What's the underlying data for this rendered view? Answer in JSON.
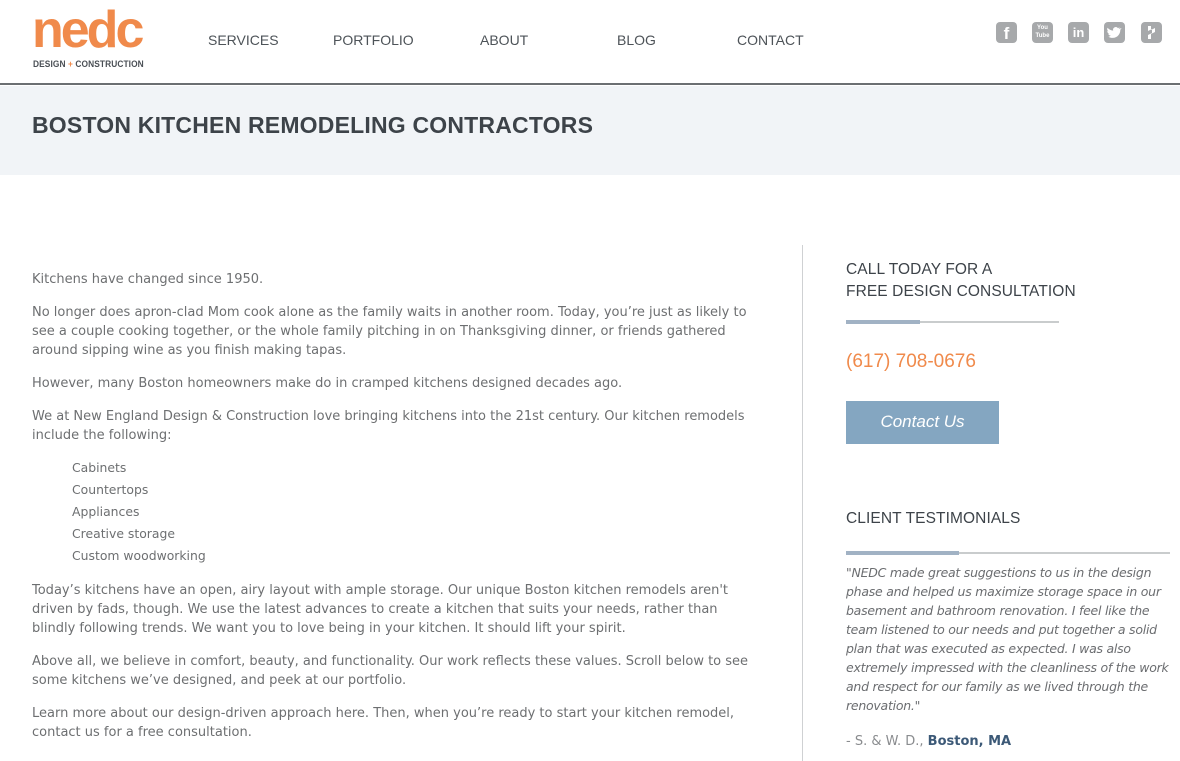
{
  "header": {
    "logo": {
      "word": "nedc",
      "sub_left": "DESIGN",
      "sub_plus": "+",
      "sub_right": "CONSTRUCTION"
    },
    "nav": [
      {
        "label": "SERVICES"
      },
      {
        "label": "PORTFOLIO"
      },
      {
        "label": "ABOUT"
      },
      {
        "label": "BLOG"
      },
      {
        "label": "CONTACT"
      }
    ],
    "social": [
      {
        "name": "facebook-icon",
        "glyph": "f"
      },
      {
        "name": "youtube-icon",
        "glyph": "You Tube"
      },
      {
        "name": "linkedin-icon",
        "glyph": "in"
      },
      {
        "name": "twitter-icon",
        "glyph": "t"
      },
      {
        "name": "houzz-icon",
        "glyph": "h"
      }
    ]
  },
  "banner": {
    "title": "BOSTON KITCHEN REMODELING CONTRACTORS"
  },
  "main": {
    "paragraphs_before": [
      "Kitchens have changed since 1950.",
      "No longer does apron-clad Mom cook alone as the family waits in another room. Today, you’re just as likely to see a couple cooking together, or the whole family pitching in on Thanksgiving dinner, or friends gathered around sipping wine as you finish making tapas.",
      "However, many Boston homeowners make do in cramped kitchens designed decades ago.",
      "We at New England Design & Construction love bringing kitchens into the 21st century. Our kitchen remodels include the following:"
    ],
    "list": [
      "Cabinets",
      "Countertops",
      "Appliances",
      "Creative storage",
      "Custom woodworking"
    ],
    "paragraphs_after": [
      "Today’s kitchens have an open, airy layout with ample storage. Our unique Boston kitchen remodels aren't driven by fads, though. We use the latest advances to create a kitchen that suits your needs, rather than blindly following trends. We want you to love being in your kitchen. It should lift your spirit.",
      "Above all, we believe in comfort, beauty, and functionality. Our work reflects these values. Scroll below to see some kitchens we’ve designed, and peek at our portfolio.",
      "Learn more about our design-driven approach here. Then, when you’re ready to start your kitchen remodel, contact us for a free consultation."
    ]
  },
  "sidebar": {
    "cta_heading_line1": "CALL TODAY FOR A",
    "cta_heading_line2": "FREE DESIGN CONSULTATION",
    "phone": "(617) 708-0676",
    "contact_button": "Contact Us",
    "testimonials_heading": "CLIENT TESTIMONIALS",
    "testimonial": {
      "quote": "\"NEDC made great suggestions to us in the design phase and helped us maximize storage space in our basement and bathroom renovation. I feel like the team listened to our needs and put together a solid plan that was executed as expected. I was also extremely impressed with the cleanliness of the work and respect for our family as we lived through the renovation.\"",
      "author": "- S. & W. D., ",
      "location": "Boston, MA"
    }
  },
  "colors": {
    "brand_orange": "#f08a4b",
    "button_blue": "#84a6c1",
    "rule_accent": "#a1b2c4",
    "banner_bg": "#f1f4f7",
    "location_link": "#3c5977"
  }
}
